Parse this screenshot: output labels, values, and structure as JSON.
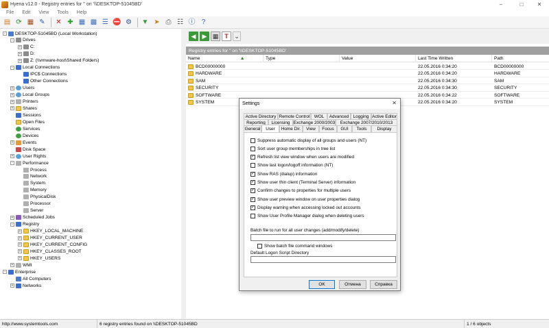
{
  "window": {
    "title": "Hyena v12.0 - Registry entries for '' on '\\\\DESKTOP-51045BD'",
    "minimize_glyph": "–",
    "maximize_glyph": "□",
    "close_glyph": "✕"
  },
  "menu": [
    "File",
    "Edit",
    "View",
    "Tools",
    "Help"
  ],
  "tree": [
    {
      "label": "DESKTOP-51045BD (Local Workstation)",
      "icon": "pc",
      "level": 0,
      "toggle": "-"
    },
    {
      "label": "Drives",
      "icon": "drive",
      "level": 1,
      "toggle": "-"
    },
    {
      "label": "C:",
      "icon": "drive",
      "level": 2,
      "toggle": "+"
    },
    {
      "label": "D:",
      "icon": "drive",
      "level": 2,
      "toggle": "+"
    },
    {
      "label": "Z: (\\\\vmware-host\\Shared Folders)",
      "icon": "drive",
      "level": 2,
      "toggle": "+"
    },
    {
      "label": "Local Connections",
      "icon": "blue",
      "level": 1,
      "toggle": "-"
    },
    {
      "label": "IPC$ Connections",
      "icon": "blue",
      "level": 2,
      "toggle": ""
    },
    {
      "label": "Other Connections",
      "icon": "blue",
      "level": 2,
      "toggle": ""
    },
    {
      "label": "Users",
      "icon": "user",
      "level": 1,
      "toggle": "+"
    },
    {
      "label": "Local Groups",
      "icon": "user",
      "level": 1,
      "toggle": "+"
    },
    {
      "label": "Printers",
      "icon": "gray",
      "level": 1,
      "toggle": "+"
    },
    {
      "label": "Shares",
      "icon": "folder",
      "level": 1,
      "toggle": "+"
    },
    {
      "label": "Sessions",
      "icon": "blue",
      "level": 1,
      "toggle": ""
    },
    {
      "label": "Open Files",
      "icon": "folder",
      "level": 1,
      "toggle": ""
    },
    {
      "label": "Services",
      "icon": "green",
      "level": 1,
      "toggle": ""
    },
    {
      "label": "Devices",
      "icon": "green",
      "level": 1,
      "toggle": ""
    },
    {
      "label": "Events",
      "icon": "orange",
      "level": 1,
      "toggle": "+"
    },
    {
      "label": "Disk Space",
      "icon": "red",
      "level": 1,
      "toggle": ""
    },
    {
      "label": "User Rights",
      "icon": "user",
      "level": 1,
      "toggle": "+"
    },
    {
      "label": "Performance",
      "icon": "gray",
      "level": 1,
      "toggle": "-"
    },
    {
      "label": "Process",
      "icon": "gray",
      "level": 2,
      "toggle": ""
    },
    {
      "label": "Network",
      "icon": "gray",
      "level": 2,
      "toggle": ""
    },
    {
      "label": "System",
      "icon": "gray",
      "level": 2,
      "toggle": ""
    },
    {
      "label": "Memory",
      "icon": "gray",
      "level": 2,
      "toggle": ""
    },
    {
      "label": "PhysicalDisk",
      "icon": "gray",
      "level": 2,
      "toggle": ""
    },
    {
      "label": "Processor",
      "icon": "gray",
      "level": 2,
      "toggle": ""
    },
    {
      "label": "Server",
      "icon": "gray",
      "level": 2,
      "toggle": ""
    },
    {
      "label": "Scheduled Jobs",
      "icon": "purple",
      "level": 1,
      "toggle": "+"
    },
    {
      "label": "Registry",
      "icon": "blue",
      "level": 1,
      "toggle": "-"
    },
    {
      "label": "HKEY_LOCAL_MACHINE",
      "icon": "folder",
      "level": 2,
      "toggle": "+"
    },
    {
      "label": "HKEY_CURRENT_USER",
      "icon": "folder",
      "level": 2,
      "toggle": "+"
    },
    {
      "label": "HKEY_CURRENT_CONFIG",
      "icon": "folder",
      "level": 2,
      "toggle": "+"
    },
    {
      "label": "HKEY_CLASSES_ROOT",
      "icon": "folder",
      "level": 2,
      "toggle": "+"
    },
    {
      "label": "HKEY_USERS",
      "icon": "folder",
      "level": 2,
      "toggle": "+"
    },
    {
      "label": "WMI",
      "icon": "gray",
      "level": 1,
      "toggle": "+"
    },
    {
      "label": "Enterprise",
      "icon": "blue",
      "level": 0,
      "toggle": "-"
    },
    {
      "label": "All Computers",
      "icon": "pc",
      "level": 1,
      "toggle": ""
    },
    {
      "label": "Networks",
      "icon": "blue",
      "level": 1,
      "toggle": "+"
    }
  ],
  "pane_title": "Registry entries for '' on '\\\\DESKTOP-51045BD'",
  "list": {
    "columns": [
      "Name",
      "Type",
      "Value",
      "Last Time Written",
      "Path"
    ],
    "rows": [
      {
        "name": "BCD00000000",
        "type": "",
        "value": "",
        "time": "22.05.2016 0:34:20",
        "path": "BCD00000000"
      },
      {
        "name": "HARDWARE",
        "type": "",
        "value": "",
        "time": "22.05.2016 0:34:20",
        "path": "HARDWARE"
      },
      {
        "name": "SAM",
        "type": "",
        "value": "",
        "time": "22.05.2016 0:34:30",
        "path": "SAM"
      },
      {
        "name": "SECURITY",
        "type": "",
        "value": "",
        "time": "22.05.2016 0:34:30",
        "path": "SECURITY"
      },
      {
        "name": "SOFTWARE",
        "type": "",
        "value": "",
        "time": "22.05.2016 0:34:22",
        "path": "SOFTWARE"
      },
      {
        "name": "SYSTEM",
        "type": "",
        "value": "",
        "time": "22.05.2016 0:34:20",
        "path": "SYSTEM"
      }
    ]
  },
  "status": {
    "url": "http://www.systemtools.com",
    "message": "6 registry entries found on \\\\DESKTOP-51045BD",
    "count": "1 / 6 objects"
  },
  "dialog": {
    "title": "Settings",
    "close_glyph": "✕",
    "tabs_row1": [
      "Active Directory",
      "Remote Control",
      "WOL",
      "Advanced",
      "Logging",
      "Active Editor"
    ],
    "tabs_row2": [
      "Reporting",
      "Licensing",
      "Exchange 2000/2003",
      "Exchange 2007/2010/2013"
    ],
    "tabs_row3": [
      "General",
      "User",
      "Home Dir.",
      "View",
      "Focus",
      "GUI",
      "Tools",
      "Display"
    ],
    "checkboxes": [
      {
        "label": "Suppress automatic display of all groups and users (NT)",
        "checked": false
      },
      {
        "label": "Sort user group memberships in tree list",
        "checked": false
      },
      {
        "label": "Refresh list view window when users are modified",
        "checked": true
      },
      {
        "label": "Show last logon/logoff information (NT)",
        "checked": false
      },
      {
        "label": "Show RAS (dialup) information",
        "checked": true
      },
      {
        "label": "Show user thin client (Terminal Server) information",
        "checked": true
      },
      {
        "label": "Confirm changes to properties for multiple users",
        "checked": true
      },
      {
        "label": "Show user preview window on user properties dialog",
        "checked": true
      },
      {
        "label": "Display warning when accessing locked out accounts",
        "checked": true
      },
      {
        "label": "Show User Profile Manager dialog when deleting users",
        "checked": false
      }
    ],
    "batch_label": "Batch file to run for all user changes (add/modify/delete)",
    "batch_value": "",
    "show_batch_label": "Show batch file command windows",
    "show_batch_checked": false,
    "logon_label": "Default Logon Script Directory",
    "logon_value": "",
    "ok": "OK",
    "cancel": "Отмена",
    "help": "Справка"
  }
}
